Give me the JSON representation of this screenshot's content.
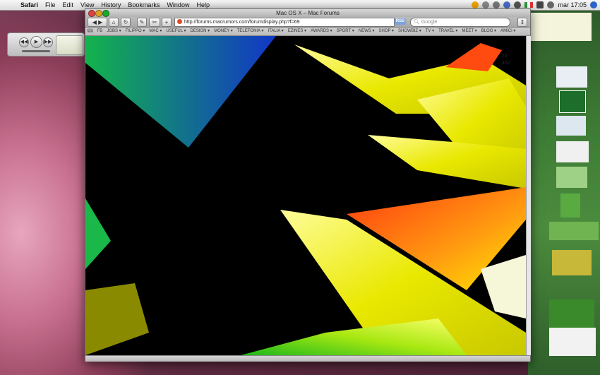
{
  "menubar": {
    "app_name": "Safari",
    "items": [
      "File",
      "Edit",
      "View",
      "History",
      "Bookmarks",
      "Window",
      "Help"
    ],
    "clock": "mar 17:05"
  },
  "window": {
    "title": "Mac OS X – Mac Forums",
    "url": "http://forums.macrumors.com/forumdisplay.php?f=69",
    "rss_label": "RSS",
    "search_placeholder": "Google"
  },
  "bookmarks": [
    "FB",
    "JOBS ▾",
    "FILIPPO ▾",
    "MAC ▾",
    "USEFUL ▾",
    "DESIGN ▾",
    "MONEY ▾",
    "TELEFONIA ▾",
    "ITALIA ▾",
    "EZINES ▾",
    "AWARDS ▾",
    "SPORT ▾",
    "NEWS ▾",
    "SHOP ▾",
    "SHOWBIZ ▾",
    "TV ▾",
    "TRAVEL ▾",
    "MEET ▾",
    "BLOG ▾",
    "AMICI ▾"
  ],
  "content": {
    "numbers": [
      "462",
      "24"
    ]
  },
  "colors": {
    "menubar_bg": "#e6e6e6",
    "close": "#e0443e",
    "minimize": "#dea123",
    "zoom": "#1aab29"
  }
}
